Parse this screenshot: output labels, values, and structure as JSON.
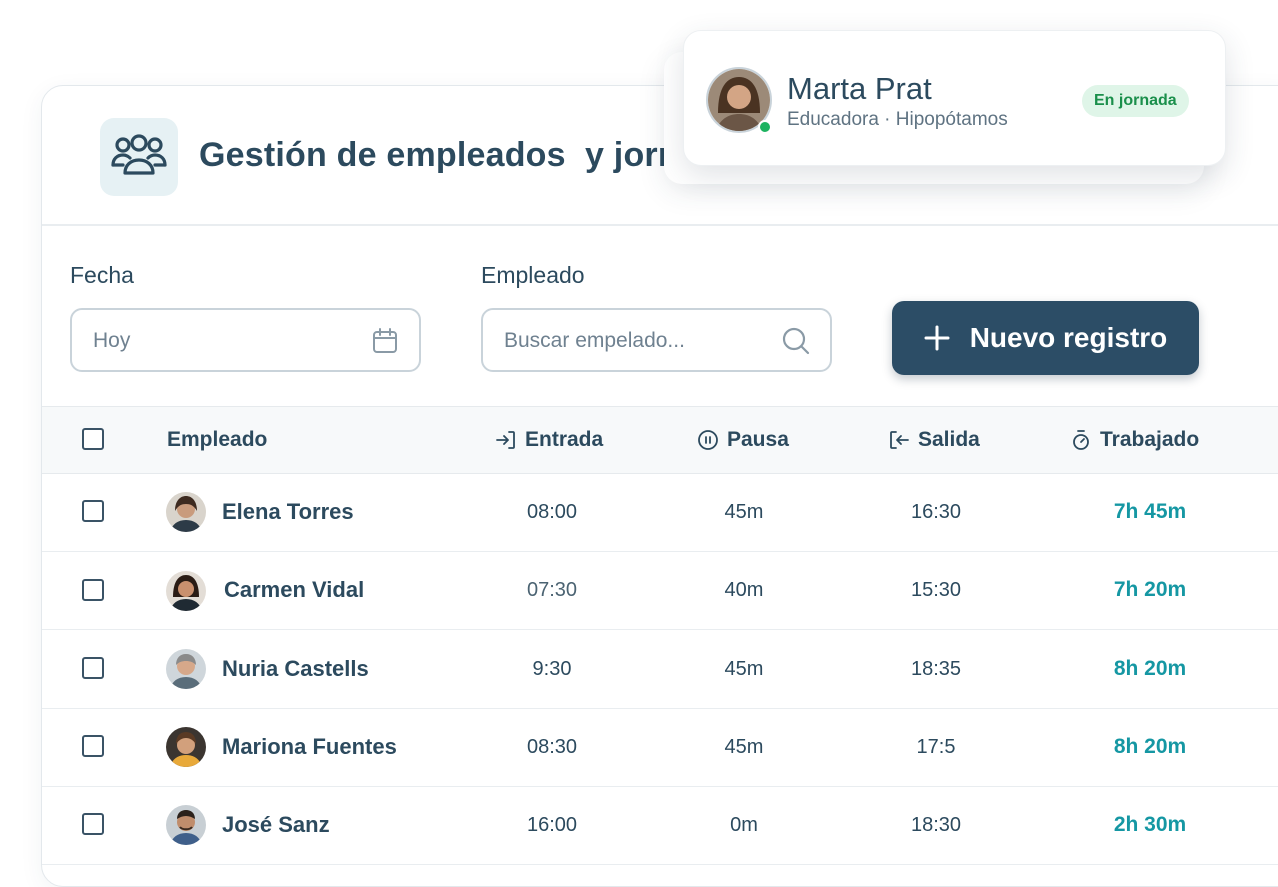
{
  "header": {
    "title": "Gestión de empleados  y jornadas"
  },
  "filters": {
    "date_label": "Fecha",
    "date_placeholder": "Hoy",
    "employee_label": "Empleado",
    "employee_placeholder": "Buscar empelado...",
    "new_button": "Nuevo registro"
  },
  "table": {
    "headers": {
      "employee": "Empleado",
      "entry": "Entrada",
      "pause": "Pausa",
      "exit": "Salida",
      "worked": "Trabajado"
    },
    "rows": [
      {
        "name": "Elena Torres",
        "entry": "08:00",
        "pause": "45m",
        "exit": "16:30",
        "worked": "7h 45m"
      },
      {
        "name": "Carmen Vidal",
        "entry": "07:30",
        "pause": "40m",
        "exit": "15:30",
        "worked": "7h 20m"
      },
      {
        "name": "Nuria Castells",
        "entry": "9:30",
        "pause": "45m",
        "exit": "18:35",
        "worked": "8h 20m"
      },
      {
        "name": "Mariona Fuentes",
        "entry": "08:30",
        "pause": "45m",
        "exit": "17:5",
        "worked": "8h 20m"
      },
      {
        "name": "José Sanz",
        "entry": "16:00",
        "pause": "0m",
        "exit": "18:30",
        "worked": "2h 30m"
      }
    ]
  },
  "profile_card": {
    "name": "Marta Prat",
    "subtitle": "Educadora · Hipopótamos",
    "status": "En jornada"
  },
  "colors": {
    "primary": "#2c4d66",
    "accent": "#1597a3",
    "status_green": "#1a8f4b"
  }
}
